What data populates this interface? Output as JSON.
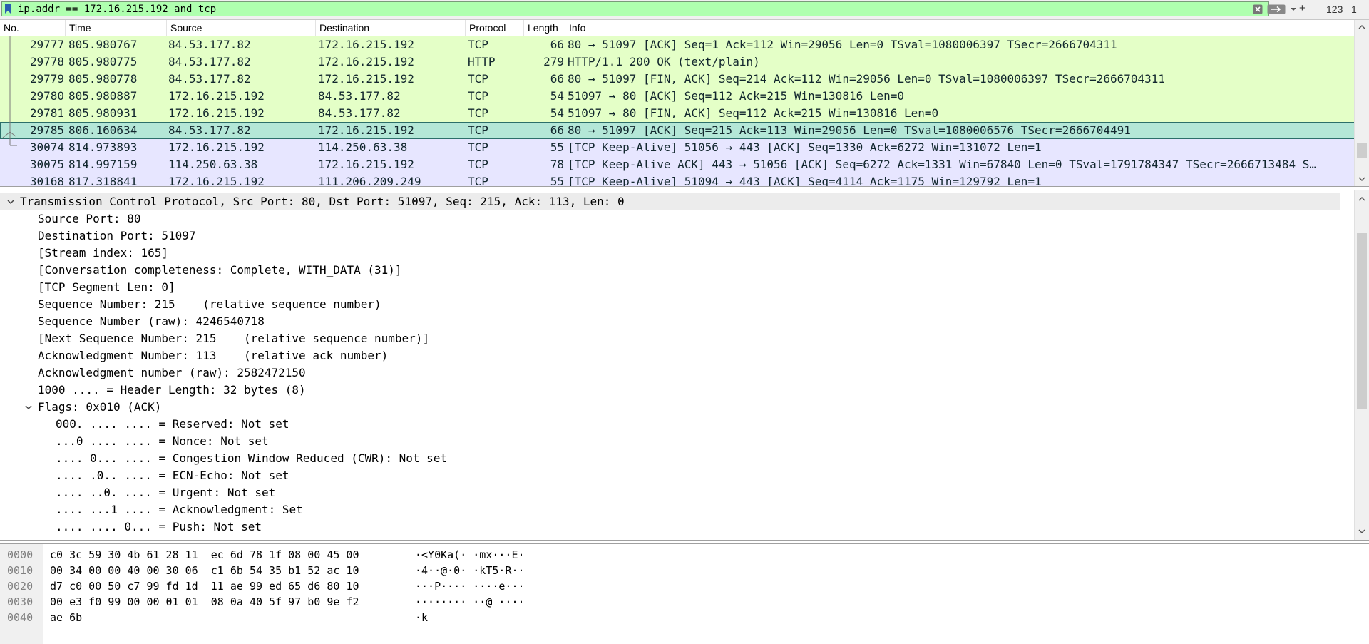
{
  "filter": {
    "text": "ip.addr == 172.16.215.192 and tcp",
    "add_label": "+",
    "button_a": "123",
    "button_b": "1"
  },
  "packet_list": {
    "columns": [
      "No.",
      "Time",
      "Source",
      "Destination",
      "Protocol",
      "Length",
      "Info"
    ],
    "rows": [
      {
        "no": "29777",
        "time": "805.980767",
        "src": "84.53.177.82",
        "dst": "172.16.215.192",
        "proto": "TCP",
        "len": "66",
        "info": "80 → 51097 [ACK] Seq=1 Ack=112 Win=29056 Len=0 TSval=1080006397 TSecr=2666704311",
        "bg": "#e4ffc7"
      },
      {
        "no": "29778",
        "time": "805.980775",
        "src": "84.53.177.82",
        "dst": "172.16.215.192",
        "proto": "HTTP",
        "len": "279",
        "info": "HTTP/1.1 200 OK  (text/plain)",
        "bg": "#e4ffc7"
      },
      {
        "no": "29779",
        "time": "805.980778",
        "src": "84.53.177.82",
        "dst": "172.16.215.192",
        "proto": "TCP",
        "len": "66",
        "info": "80 → 51097 [FIN, ACK] Seq=214 Ack=112 Win=29056 Len=0 TSval=1080006397 TSecr=2666704311",
        "bg": "#e4ffc7"
      },
      {
        "no": "29780",
        "time": "805.980887",
        "src": "172.16.215.192",
        "dst": "84.53.177.82",
        "proto": "TCP",
        "len": "54",
        "info": "51097 → 80 [ACK] Seq=112 Ack=215 Win=130816 Len=0",
        "bg": "#e4ffc7"
      },
      {
        "no": "29781",
        "time": "805.980931",
        "src": "172.16.215.192",
        "dst": "84.53.177.82",
        "proto": "TCP",
        "len": "54",
        "info": "51097 → 80 [FIN, ACK] Seq=112 Ack=215 Win=130816 Len=0",
        "bg": "#e4ffc7"
      },
      {
        "no": "29785",
        "time": "806.160634",
        "src": "84.53.177.82",
        "dst": "172.16.215.192",
        "proto": "TCP",
        "len": "66",
        "info": "80 → 51097 [ACK] Seq=215 Ack=113 Win=29056 Len=0 TSval=1080006576 TSecr=2666704491",
        "bg": "#b4e7d7"
      },
      {
        "no": "30074",
        "time": "814.973893",
        "src": "172.16.215.192",
        "dst": "114.250.63.38",
        "proto": "TCP",
        "len": "55",
        "info": "[TCP Keep-Alive] 51056 → 443 [ACK] Seq=1330 Ack=6272 Win=131072 Len=1",
        "bg": "#e7e6ff"
      },
      {
        "no": "30075",
        "time": "814.997159",
        "src": "114.250.63.38",
        "dst": "172.16.215.192",
        "proto": "TCP",
        "len": "78",
        "info": "[TCP Keep-Alive ACK] 443 → 51056 [ACK] Seq=6272 Ack=1331 Win=67840 Len=0 TSval=1791784347 TSecr=2666713484 S…",
        "bg": "#e7e6ff"
      },
      {
        "no": "30168",
        "time": "817.318841",
        "src": "172.16.215.192",
        "dst": "111.206.209.249",
        "proto": "TCP",
        "len": "55",
        "info": "[TCP Keep-Alive] 51094 → 443 [ACK] Seq=4114 Ack=1175 Win=129792 Len=1",
        "bg": "#e7e6ff"
      }
    ]
  },
  "details": {
    "lines": [
      {
        "text": "Transmission Control Protocol, Src Port: 80, Dst Port: 51097, Seq: 215, Ack: 113, Len: 0",
        "indent": 0,
        "expander": "open",
        "highlight": true
      },
      {
        "text": "Source Port: 80",
        "indent": 1
      },
      {
        "text": "Destination Port: 51097",
        "indent": 1
      },
      {
        "text": "[Stream index: 165]",
        "indent": 1
      },
      {
        "text": "[Conversation completeness: Complete, WITH_DATA (31)]",
        "indent": 1
      },
      {
        "text": "[TCP Segment Len: 0]",
        "indent": 1
      },
      {
        "text": "Sequence Number: 215    (relative sequence number)",
        "indent": 1
      },
      {
        "text": "Sequence Number (raw): 4246540718",
        "indent": 1
      },
      {
        "text": "[Next Sequence Number: 215    (relative sequence number)]",
        "indent": 1
      },
      {
        "text": "Acknowledgment Number: 113    (relative ack number)",
        "indent": 1
      },
      {
        "text": "Acknowledgment number (raw): 2582472150",
        "indent": 1
      },
      {
        "text": "1000 .... = Header Length: 32 bytes (8)",
        "indent": 1
      },
      {
        "text": "Flags: 0x010 (ACK)",
        "indent": 1,
        "expander": "open"
      },
      {
        "text": "000. .... .... = Reserved: Not set",
        "indent": 2
      },
      {
        "text": "...0 .... .... = Nonce: Not set",
        "indent": 2
      },
      {
        "text": ".... 0... .... = Congestion Window Reduced (CWR): Not set",
        "indent": 2
      },
      {
        "text": ".... .0.. .... = ECN-Echo: Not set",
        "indent": 2
      },
      {
        "text": ".... ..0. .... = Urgent: Not set",
        "indent": 2
      },
      {
        "text": ".... ...1 .... = Acknowledgment: Set",
        "indent": 2
      },
      {
        "text": ".... .... 0... = Push: Not set",
        "indent": 2
      }
    ]
  },
  "bytes": {
    "rows": [
      {
        "offset": "0000",
        "hex": "c0 3c 59 30 4b 61 28 11  ec 6d 78 1f 08 00 45 00",
        "ascii": "·<Y0Ka(· ·mx···E·"
      },
      {
        "offset": "0010",
        "hex": "00 34 00 00 40 00 30 06  c1 6b 54 35 b1 52 ac 10",
        "ascii": "·4··@·0· ·kT5·R··"
      },
      {
        "offset": "0020",
        "hex": "d7 c0 00 50 c7 99 fd 1d  11 ae 99 ed 65 d6 80 10",
        "ascii": "···P···· ····e···"
      },
      {
        "offset": "0030",
        "hex": "00 e3 f0 99 00 00 01 01  08 0a 40 5f 97 b0 9e f2",
        "ascii": "········ ··@_····"
      },
      {
        "offset": "0040",
        "hex": "ae 6b",
        "ascii": "·k"
      }
    ]
  },
  "colors": {
    "filter_valid": "#afffaf",
    "tcp_row": "#e4ffc7",
    "selected_row": "#b4e7d7",
    "keepalive_row": "#e7e6ff"
  }
}
